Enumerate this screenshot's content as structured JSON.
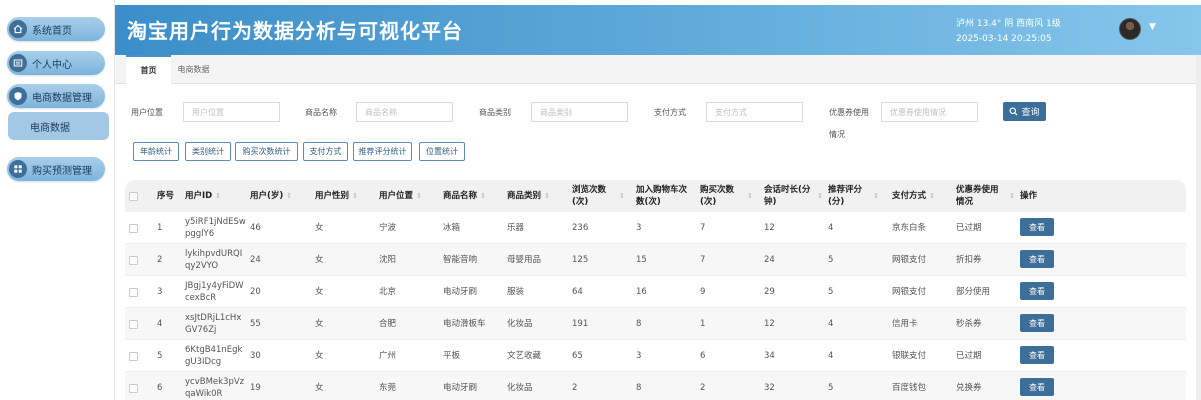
{
  "sidebar": {
    "items": [
      {
        "label": "系统首页",
        "icon": "home-icon"
      },
      {
        "label": "个人中心",
        "icon": "profile-card-icon"
      },
      {
        "label": "电商数据管理",
        "icon": "shield-icon"
      },
      {
        "label": "购买预测管理",
        "icon": "grid-icon"
      }
    ],
    "sub_item": "电商数据"
  },
  "header": {
    "title": "淘宝用户行为数据分析与可视化平台",
    "weather": "泸州  13.4°  阴  西南风  1级",
    "datetime": "2025-03-14 20:25:05",
    "caret": "▼"
  },
  "tabs": [
    {
      "label": "首页",
      "active": true
    },
    {
      "label": "电商数据",
      "active": false
    }
  ],
  "filters": {
    "user_location": {
      "label": "用户位置",
      "placeholder": "用户位置"
    },
    "product_name": {
      "label": "商品名称",
      "placeholder": "商品名称"
    },
    "product_category": {
      "label": "商品类别",
      "placeholder": "商品类别"
    },
    "payment_method": {
      "label": "支付方式",
      "placeholder": "支付方式"
    },
    "coupon_usage": {
      "label_line1": "优惠券使用",
      "label_line2": "情况",
      "placeholder": "优惠券使用情况"
    },
    "query_label": "查询"
  },
  "stat_buttons": [
    "年龄统计",
    "类别统计",
    "购买次数统计",
    "支付方式",
    "推荐评分统计",
    "位置统计"
  ],
  "table": {
    "headers": [
      "序号",
      "用户ID",
      "用户(岁)",
      "用户性别",
      "用户位置",
      "商品名称",
      "商品类别",
      "浏览次数(次)",
      "加入购物车次数(次)",
      "购买次数(次)",
      "会话时长(分钟)",
      "推荐评分(分)",
      "支付方式",
      "优惠券使用情况",
      "操作"
    ],
    "sort_glyph": "⇕",
    "action_label": "查看",
    "rows": [
      {
        "no": "1",
        "uid": "y5iRF1jNdESwpgglY6",
        "age": "46",
        "gender": "女",
        "location": "宁波",
        "product": "冰箱",
        "category": "乐器",
        "views": "236",
        "cart": "3",
        "buys": "7",
        "session": "12",
        "rating": "4",
        "payment": "京东白条",
        "coupon": "已过期"
      },
      {
        "no": "2",
        "uid": "lykihpvdURQIqy2VYO",
        "age": "24",
        "gender": "女",
        "location": "沈阳",
        "product": "智能音响",
        "category": "母婴用品",
        "views": "125",
        "cart": "15",
        "buys": "7",
        "session": "24",
        "rating": "5",
        "payment": "网银支付",
        "coupon": "折扣券"
      },
      {
        "no": "3",
        "uid": "JBgj1y4yFiDWcexBcR",
        "age": "20",
        "gender": "女",
        "location": "北京",
        "product": "电动牙刷",
        "category": "服装",
        "views": "64",
        "cart": "16",
        "buys": "9",
        "session": "29",
        "rating": "5",
        "payment": "网银支付",
        "coupon": "部分使用"
      },
      {
        "no": "4",
        "uid": "xsJtDRjL1cHxGV76Zj",
        "age": "55",
        "gender": "女",
        "location": "合肥",
        "product": "电动滑板车",
        "category": "化妆品",
        "views": "191",
        "cart": "8",
        "buys": "1",
        "session": "12",
        "rating": "4",
        "payment": "信用卡",
        "coupon": "秒杀券"
      },
      {
        "no": "5",
        "uid": "6KtgB41nEgkgU3IDcg",
        "age": "30",
        "gender": "女",
        "location": "广州",
        "product": "平板",
        "category": "文艺收藏",
        "views": "65",
        "cart": "3",
        "buys": "6",
        "session": "34",
        "rating": "4",
        "payment": "银联支付",
        "coupon": "已过期"
      },
      {
        "no": "6",
        "uid": "ycvBMek3pVzqaWik0R",
        "age": "19",
        "gender": "女",
        "location": "东莞",
        "product": "电动牙刷",
        "category": "化妆品",
        "views": "2",
        "cart": "8",
        "buys": "2",
        "session": "32",
        "rating": "5",
        "payment": "百度钱包",
        "coupon": "兑换券"
      }
    ]
  }
}
